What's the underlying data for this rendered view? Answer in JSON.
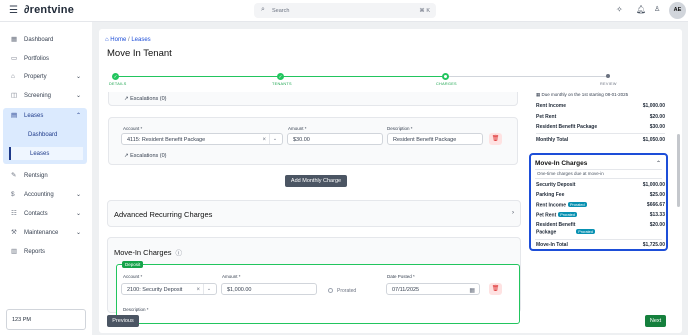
{
  "topbar": {
    "menu_icon": "hamburger-icon",
    "logo": "∂rentvine",
    "search_placeholder": "Search",
    "search_shortcut": "⌘ K",
    "avatar": "AE"
  },
  "sidebar": {
    "items": [
      {
        "label": "Dashboard",
        "icon": "dashboard-icon"
      },
      {
        "label": "Portfolios",
        "icon": "briefcase-icon"
      },
      {
        "label": "Property",
        "icon": "building-icon"
      },
      {
        "label": "Screening",
        "icon": "screening-icon"
      },
      {
        "label": "Leases",
        "icon": "lease-icon"
      },
      {
        "label": "Rentsign",
        "icon": "rentsign-icon"
      },
      {
        "label": "Accounting",
        "icon": "dollar-icon"
      },
      {
        "label": "Contacts",
        "icon": "contacts-icon"
      },
      {
        "label": "Maintenance",
        "icon": "wrench-icon"
      },
      {
        "label": "Reports",
        "icon": "chart-icon"
      }
    ],
    "leases_sub": [
      "Dashboard",
      "Leases"
    ],
    "property_selector": "123 PM"
  },
  "breadcrumb": {
    "home": "Home",
    "sep": "/",
    "current": "Leases"
  },
  "page_title": "Move In Tenant",
  "steps": [
    "DETAILS",
    "TENANTS",
    "CHARGES",
    "REVIEW"
  ],
  "recurring": {
    "escalations_label": "Escalations (0)",
    "account_label": "Account *",
    "amount_label": "Amount *",
    "description_label": "Description *",
    "account_value": "4115: Resident Benefit Package",
    "amount_value": "$30.00",
    "description_value": "Resident Benefit Package",
    "add_monthly": "Add Monthly Charge"
  },
  "advanced_recurring": "Advanced Recurring Charges",
  "move_in": {
    "title": "Move-In Charges",
    "deposit_badge": "Deposit",
    "account_label": "Account *",
    "amount_label": "Amount *",
    "date_label": "Date Posted *",
    "description_label": "Description *",
    "account_value": "2100: Security Deposit",
    "amount_value": "$1,000.00",
    "prorated": "Prorated",
    "date_value": "07/11/2025"
  },
  "buttons": {
    "previous": "Previous",
    "next": "Next"
  },
  "summary": {
    "due_text": "Due monthly on the 1st starting 08-01-2025",
    "monthly_rows": [
      {
        "name": "Rent Income",
        "amount": "$1,000.00"
      },
      {
        "name": "Pet Rent",
        "amount": "$20.00"
      },
      {
        "name": "Resident Benefit Package",
        "amount": "$30.00"
      }
    ],
    "monthly_total": {
      "name": "Monthly Total",
      "amount": "$1,050.00"
    },
    "movein_title": "Move-In Charges",
    "movein_sub": "One-time charges due at move-in",
    "movein_rows": [
      {
        "name": "Security Deposit",
        "amount": "$1,000.00",
        "badge": ""
      },
      {
        "name": "Parking Fee",
        "amount": "$25.00",
        "badge": ""
      },
      {
        "name": "Rent Income",
        "amount": "$666.67",
        "badge": "Prorated"
      },
      {
        "name": "Pet Rent",
        "amount": "$13.33",
        "badge": "Prorated"
      },
      {
        "name": "Resident Benefit",
        "name2": "Package",
        "amount": "$20.00",
        "badge": "Prorated"
      }
    ],
    "movein_total": {
      "name": "Move-In Total",
      "amount": "$1,725.00"
    }
  }
}
